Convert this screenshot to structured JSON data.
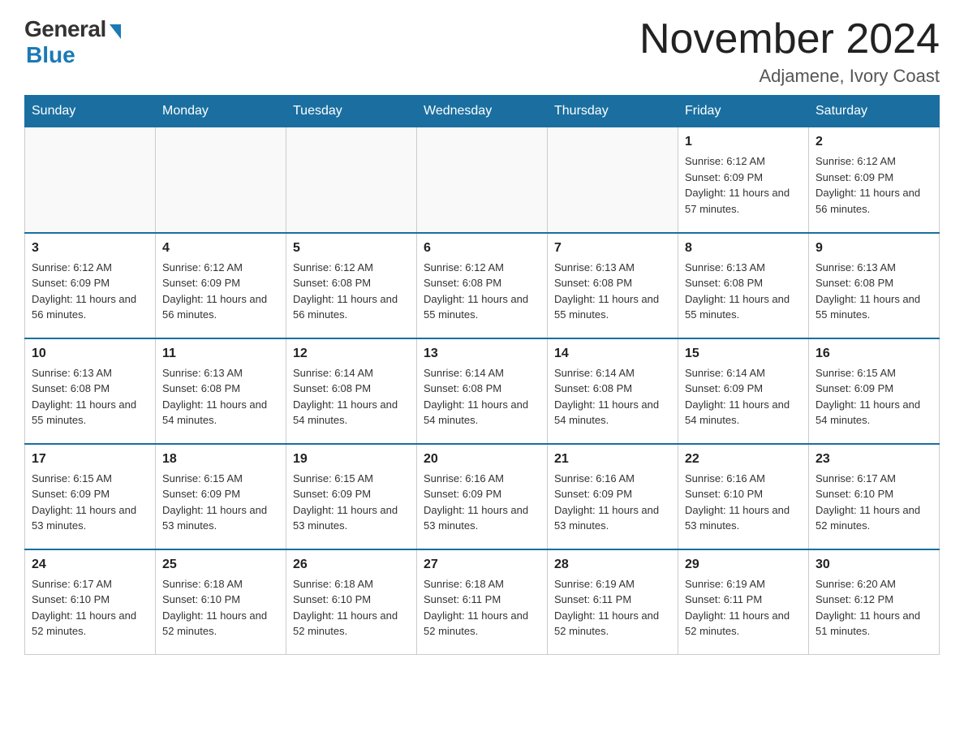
{
  "header": {
    "logo_general": "General",
    "logo_blue": "Blue",
    "month_title": "November 2024",
    "location": "Adjamene, Ivory Coast"
  },
  "weekdays": [
    "Sunday",
    "Monday",
    "Tuesday",
    "Wednesday",
    "Thursday",
    "Friday",
    "Saturday"
  ],
  "weeks": [
    [
      {
        "day": "",
        "info": ""
      },
      {
        "day": "",
        "info": ""
      },
      {
        "day": "",
        "info": ""
      },
      {
        "day": "",
        "info": ""
      },
      {
        "day": "",
        "info": ""
      },
      {
        "day": "1",
        "info": "Sunrise: 6:12 AM\nSunset: 6:09 PM\nDaylight: 11 hours and 57 minutes."
      },
      {
        "day": "2",
        "info": "Sunrise: 6:12 AM\nSunset: 6:09 PM\nDaylight: 11 hours and 56 minutes."
      }
    ],
    [
      {
        "day": "3",
        "info": "Sunrise: 6:12 AM\nSunset: 6:09 PM\nDaylight: 11 hours and 56 minutes."
      },
      {
        "day": "4",
        "info": "Sunrise: 6:12 AM\nSunset: 6:09 PM\nDaylight: 11 hours and 56 minutes."
      },
      {
        "day": "5",
        "info": "Sunrise: 6:12 AM\nSunset: 6:08 PM\nDaylight: 11 hours and 56 minutes."
      },
      {
        "day": "6",
        "info": "Sunrise: 6:12 AM\nSunset: 6:08 PM\nDaylight: 11 hours and 55 minutes."
      },
      {
        "day": "7",
        "info": "Sunrise: 6:13 AM\nSunset: 6:08 PM\nDaylight: 11 hours and 55 minutes."
      },
      {
        "day": "8",
        "info": "Sunrise: 6:13 AM\nSunset: 6:08 PM\nDaylight: 11 hours and 55 minutes."
      },
      {
        "day": "9",
        "info": "Sunrise: 6:13 AM\nSunset: 6:08 PM\nDaylight: 11 hours and 55 minutes."
      }
    ],
    [
      {
        "day": "10",
        "info": "Sunrise: 6:13 AM\nSunset: 6:08 PM\nDaylight: 11 hours and 55 minutes."
      },
      {
        "day": "11",
        "info": "Sunrise: 6:13 AM\nSunset: 6:08 PM\nDaylight: 11 hours and 54 minutes."
      },
      {
        "day": "12",
        "info": "Sunrise: 6:14 AM\nSunset: 6:08 PM\nDaylight: 11 hours and 54 minutes."
      },
      {
        "day": "13",
        "info": "Sunrise: 6:14 AM\nSunset: 6:08 PM\nDaylight: 11 hours and 54 minutes."
      },
      {
        "day": "14",
        "info": "Sunrise: 6:14 AM\nSunset: 6:08 PM\nDaylight: 11 hours and 54 minutes."
      },
      {
        "day": "15",
        "info": "Sunrise: 6:14 AM\nSunset: 6:09 PM\nDaylight: 11 hours and 54 minutes."
      },
      {
        "day": "16",
        "info": "Sunrise: 6:15 AM\nSunset: 6:09 PM\nDaylight: 11 hours and 54 minutes."
      }
    ],
    [
      {
        "day": "17",
        "info": "Sunrise: 6:15 AM\nSunset: 6:09 PM\nDaylight: 11 hours and 53 minutes."
      },
      {
        "day": "18",
        "info": "Sunrise: 6:15 AM\nSunset: 6:09 PM\nDaylight: 11 hours and 53 minutes."
      },
      {
        "day": "19",
        "info": "Sunrise: 6:15 AM\nSunset: 6:09 PM\nDaylight: 11 hours and 53 minutes."
      },
      {
        "day": "20",
        "info": "Sunrise: 6:16 AM\nSunset: 6:09 PM\nDaylight: 11 hours and 53 minutes."
      },
      {
        "day": "21",
        "info": "Sunrise: 6:16 AM\nSunset: 6:09 PM\nDaylight: 11 hours and 53 minutes."
      },
      {
        "day": "22",
        "info": "Sunrise: 6:16 AM\nSunset: 6:10 PM\nDaylight: 11 hours and 53 minutes."
      },
      {
        "day": "23",
        "info": "Sunrise: 6:17 AM\nSunset: 6:10 PM\nDaylight: 11 hours and 52 minutes."
      }
    ],
    [
      {
        "day": "24",
        "info": "Sunrise: 6:17 AM\nSunset: 6:10 PM\nDaylight: 11 hours and 52 minutes."
      },
      {
        "day": "25",
        "info": "Sunrise: 6:18 AM\nSunset: 6:10 PM\nDaylight: 11 hours and 52 minutes."
      },
      {
        "day": "26",
        "info": "Sunrise: 6:18 AM\nSunset: 6:10 PM\nDaylight: 11 hours and 52 minutes."
      },
      {
        "day": "27",
        "info": "Sunrise: 6:18 AM\nSunset: 6:11 PM\nDaylight: 11 hours and 52 minutes."
      },
      {
        "day": "28",
        "info": "Sunrise: 6:19 AM\nSunset: 6:11 PM\nDaylight: 11 hours and 52 minutes."
      },
      {
        "day": "29",
        "info": "Sunrise: 6:19 AM\nSunset: 6:11 PM\nDaylight: 11 hours and 52 minutes."
      },
      {
        "day": "30",
        "info": "Sunrise: 6:20 AM\nSunset: 6:12 PM\nDaylight: 11 hours and 51 minutes."
      }
    ]
  ]
}
